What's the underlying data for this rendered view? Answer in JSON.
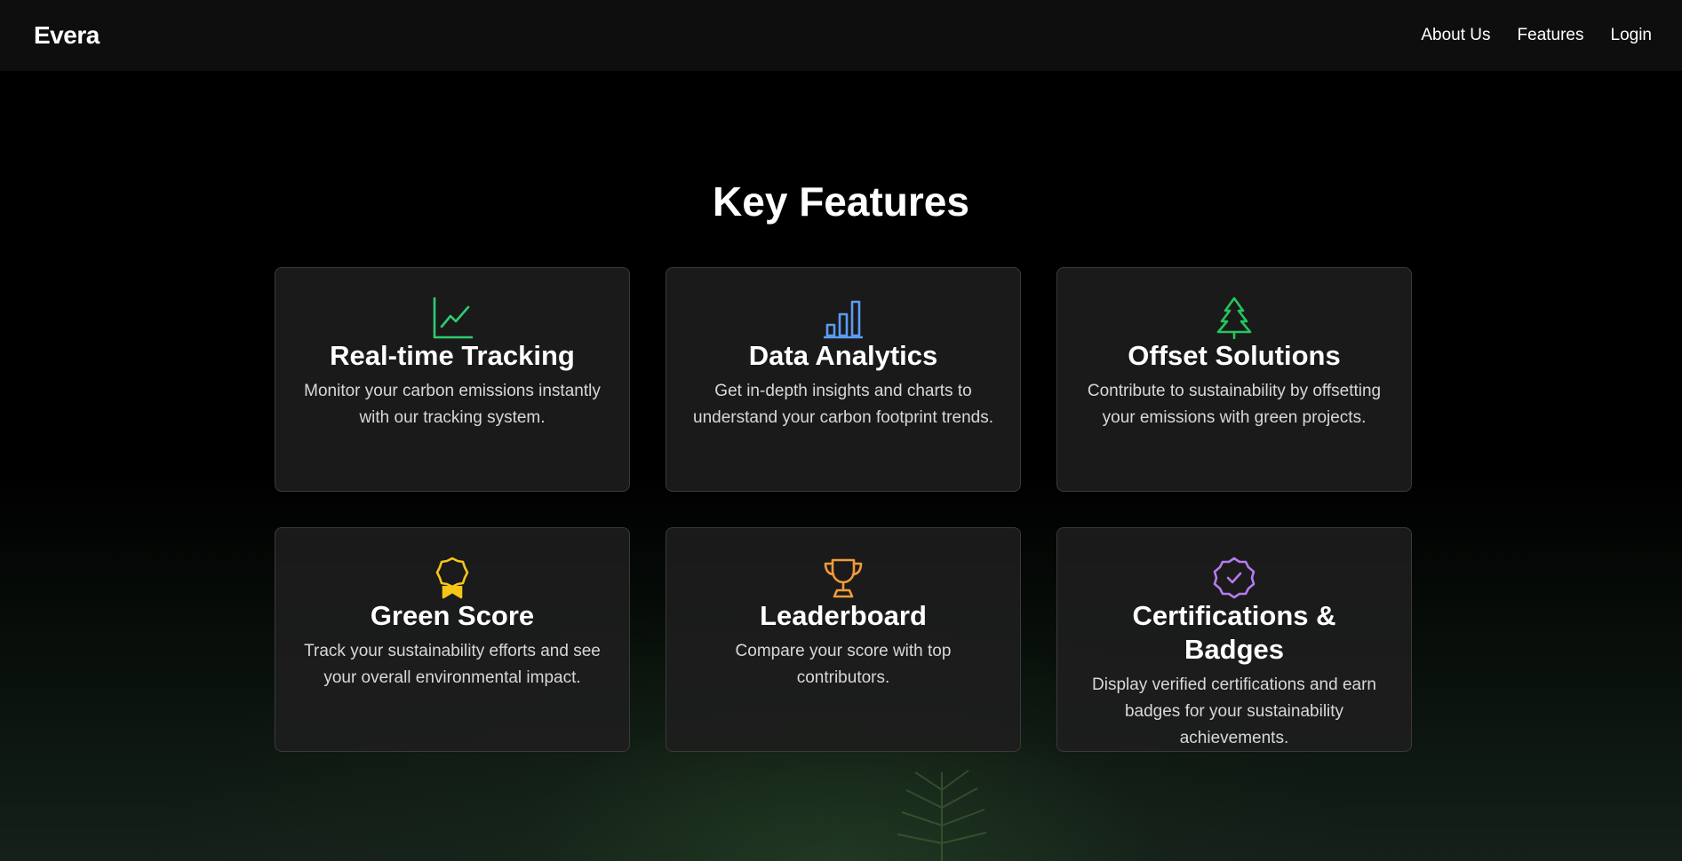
{
  "navbar": {
    "brand": "Evera",
    "links": [
      "About Us",
      "Features",
      "Login"
    ]
  },
  "main": {
    "title": "Key Features",
    "features": [
      {
        "icon": "line-chart-icon",
        "color": "#2ecc71",
        "title": "Real-time Tracking",
        "desc": "Monitor your carbon emissions instantly with our tracking system."
      },
      {
        "icon": "bar-chart-icon",
        "color": "#5b9cf2",
        "title": "Data Analytics",
        "desc": "Get in-depth insights and charts to understand your carbon footprint trends."
      },
      {
        "icon": "tree-icon",
        "color": "#27c45f",
        "title": "Offset Solutions",
        "desc": "Contribute to sustainability by offsetting your emissions with green projects."
      },
      {
        "icon": "award-icon",
        "color": "#f5c518",
        "title": "Green Score",
        "desc": "Track your sustainability efforts and see your overall environmental impact."
      },
      {
        "icon": "trophy-icon",
        "color": "#f29a3a",
        "title": "Leaderboard",
        "desc": "Compare your score with top contributors."
      },
      {
        "icon": "badge-check-icon",
        "color": "#b57bee",
        "title": "Certifications & Badges",
        "desc": "Display verified certifications and earn badges for your sustainability achievements."
      }
    ]
  }
}
